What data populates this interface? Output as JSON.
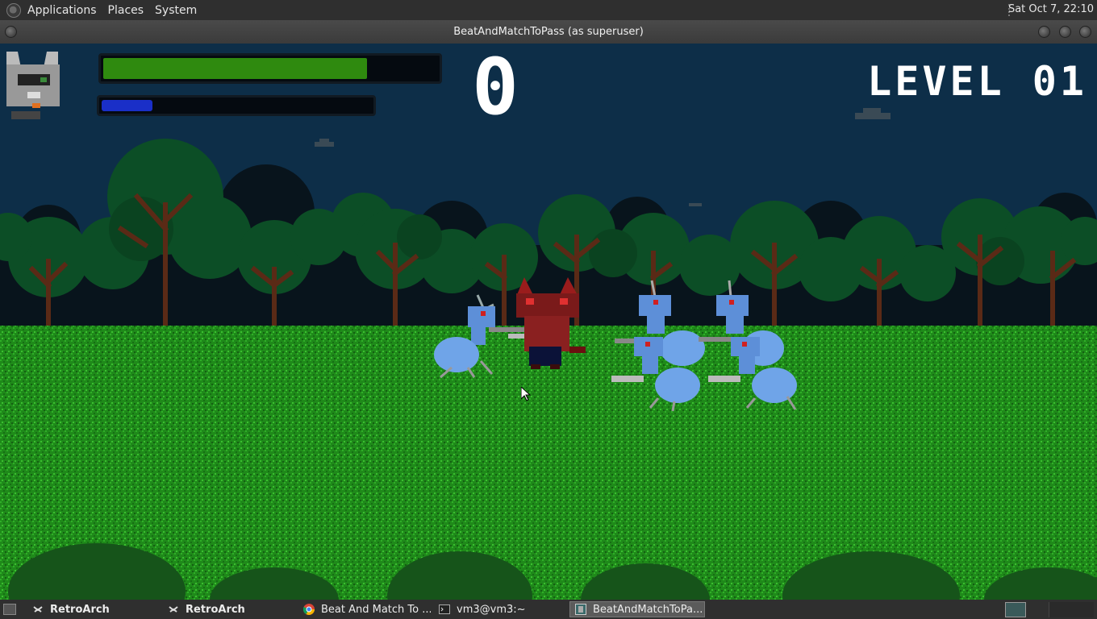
{
  "top_panel": {
    "menus": [
      "Applications",
      "Places",
      "System"
    ],
    "clock": "Sat Oct  7, 22:10"
  },
  "window": {
    "title": "BeatAndMatchToPass (as superuser)"
  },
  "hud": {
    "score": "0",
    "level": "LEVEL 01",
    "health_fraction": 0.79,
    "mana_fraction": 0.19,
    "colors": {
      "health": "#2f8a0f",
      "mana": "#1a2fc8"
    }
  },
  "taskbar": {
    "items": [
      {
        "label": "RetroArch",
        "icon": "retroarch-icon",
        "active": false
      },
      {
        "label": "RetroArch",
        "icon": "retroarch-icon",
        "active": false
      },
      {
        "label": "Beat And Match To ...",
        "icon": "chrome-icon",
        "active": false
      },
      {
        "label": "vm3@vm3:~",
        "icon": "terminal-icon",
        "active": false
      },
      {
        "label": "BeatAndMatchToPa...",
        "icon": "game-window-icon",
        "active": true
      }
    ]
  }
}
